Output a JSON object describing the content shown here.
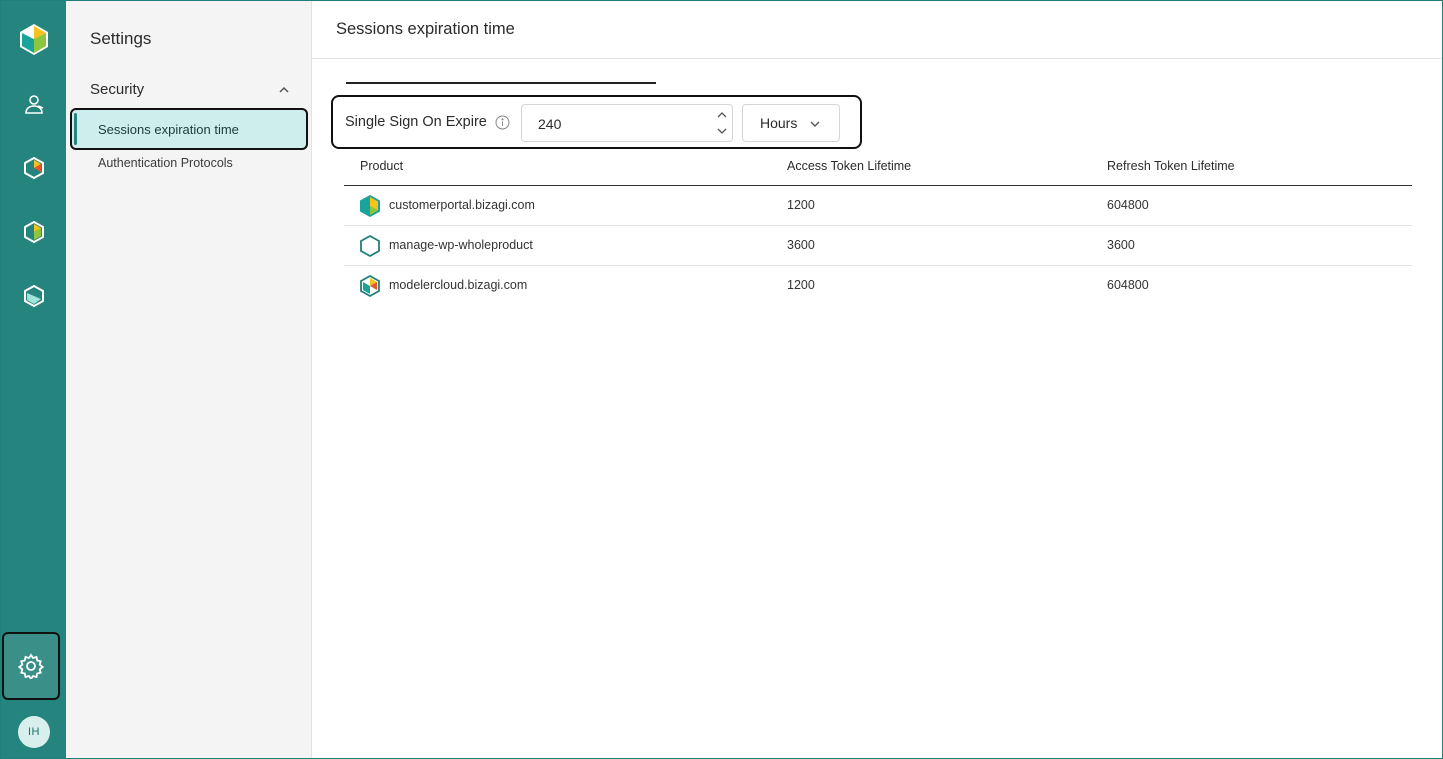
{
  "rail": {
    "items": [
      {
        "name": "bizagi-logo-icon"
      },
      {
        "name": "users-icon"
      },
      {
        "name": "modeler-product-icon"
      },
      {
        "name": "portal-product-icon"
      },
      {
        "name": "automation-product-icon"
      }
    ],
    "settings_icon": "gear-icon",
    "avatar_initials": "IH",
    "accent_color": "#25847d"
  },
  "nav": {
    "title": "Settings",
    "section": "Security",
    "items": [
      {
        "label": "Sessions expiration time",
        "active": true
      },
      {
        "label": "Authentication Protocols",
        "active": false
      }
    ]
  },
  "main": {
    "title": "Sessions expiration time",
    "sso": {
      "label": "Single Sign On Expire",
      "value": "240",
      "unit": "Hours"
    },
    "table": {
      "headers": [
        "Product",
        "Access Token Lifetime",
        "Refresh Token Lifetime"
      ],
      "rows": [
        {
          "product": "customerportal.bizagi.com",
          "access": "1200",
          "refresh": "604800",
          "icon": "customer-portal-icon"
        },
        {
          "product": "manage-wp-wholeproduct",
          "access": "3600",
          "refresh": "3600",
          "icon": "hexagon-outline-icon"
        },
        {
          "product": "modelercloud.bizagi.com",
          "access": "1200",
          "refresh": "604800",
          "icon": "modeler-cloud-icon"
        }
      ]
    }
  }
}
